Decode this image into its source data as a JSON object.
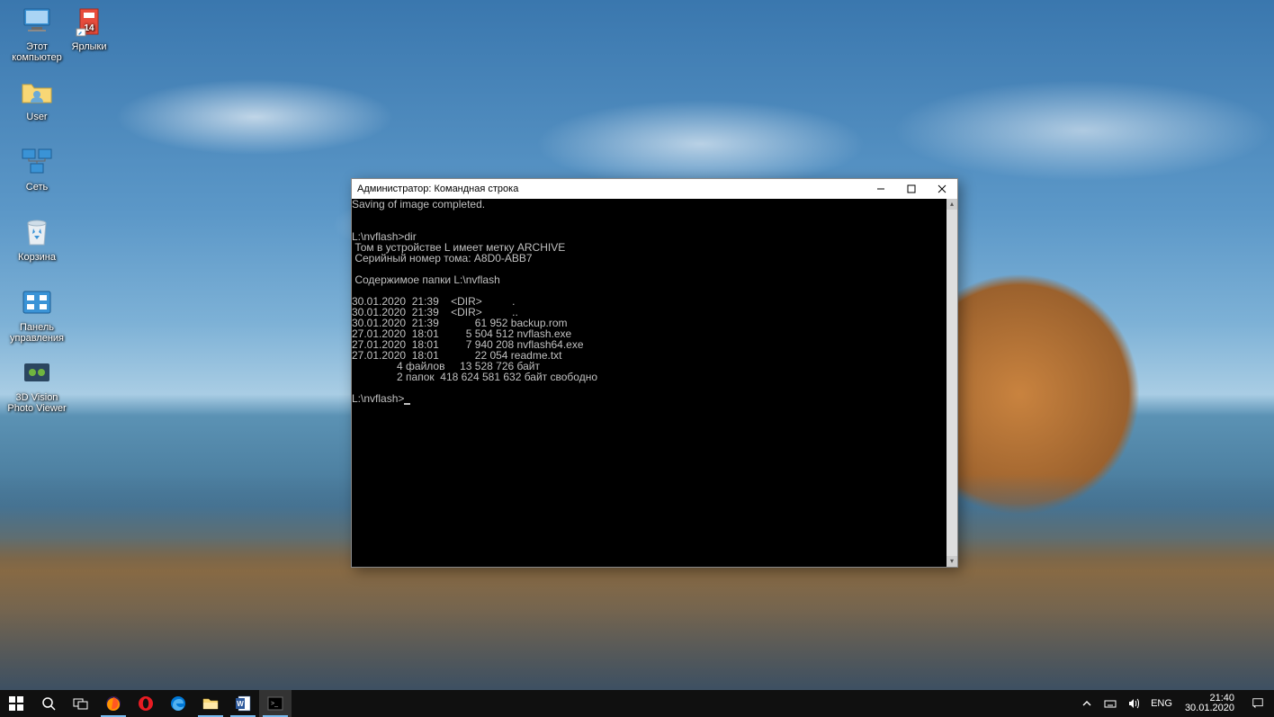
{
  "desktop_icons": [
    {
      "id": "this-pc",
      "label": "Этот\nкомпьютер"
    },
    {
      "id": "user",
      "label": "User"
    },
    {
      "id": "network",
      "label": "Сеть"
    },
    {
      "id": "recycle",
      "label": "Корзина"
    },
    {
      "id": "control-panel",
      "label": "Панель\nуправления"
    },
    {
      "id": "3dvision",
      "label": "3D Vision\nPhoto Viewer"
    },
    {
      "id": "shortcuts",
      "label": "Ярлыки"
    }
  ],
  "window": {
    "title": "Администратор: Командная строка",
    "minimize": "–",
    "maximize": "□",
    "close": "✕"
  },
  "terminal": {
    "lines": [
      "Saving of image completed.",
      "",
      "",
      "L:\\nvflash>dir",
      " Том в устройстве L имеет метку ARCHIVE",
      " Серийный номер тома: A8D0-ABB7",
      "",
      " Содержимое папки L:\\nvflash",
      "",
      "30.01.2020  21:39    <DIR>          .",
      "30.01.2020  21:39    <DIR>          ..",
      "30.01.2020  21:39            61 952 backup.rom",
      "27.01.2020  18:01         5 504 512 nvflash.exe",
      "27.01.2020  18:01         7 940 208 nvflash64.exe",
      "27.01.2020  18:01            22 054 readme.txt",
      "               4 файлов     13 528 726 байт",
      "               2 папок  418 624 581 632 байт свободно",
      ""
    ],
    "prompt": "L:\\nvflash>"
  },
  "taskbar": {
    "apps": [
      {
        "id": "start",
        "name": "start-button"
      },
      {
        "id": "search",
        "name": "search-button"
      },
      {
        "id": "taskview",
        "name": "task-view-button"
      },
      {
        "id": "firefox",
        "name": "firefox-button",
        "running": true
      },
      {
        "id": "opera",
        "name": "opera-button"
      },
      {
        "id": "edge",
        "name": "edge-button"
      },
      {
        "id": "explorer",
        "name": "file-explorer-button",
        "running": true
      },
      {
        "id": "word",
        "name": "word-button",
        "running": true
      },
      {
        "id": "cmd",
        "name": "cmd-button",
        "running": true,
        "active": true
      }
    ]
  },
  "tray": {
    "lang": "ENG",
    "time": "21:40",
    "date": "30.01.2020"
  }
}
